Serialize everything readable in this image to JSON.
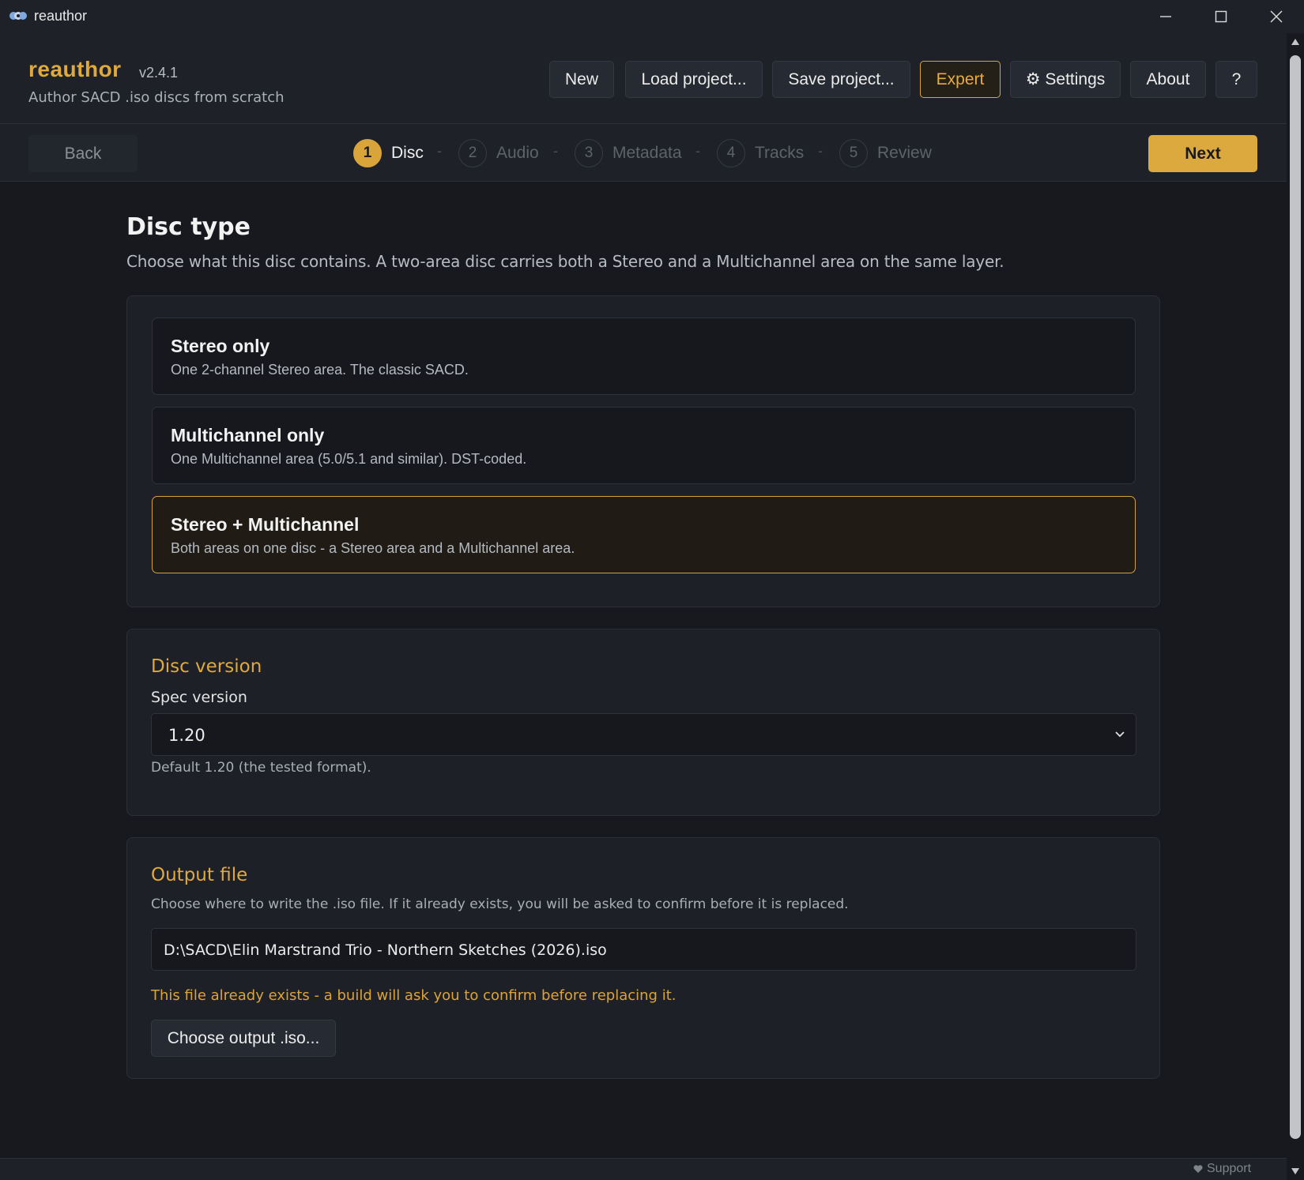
{
  "window": {
    "title": "reauthor"
  },
  "header": {
    "brand": "reauthor",
    "version": "v2.4.1",
    "subtitle": "Author SACD .iso discs from scratch",
    "buttons": {
      "new": "New",
      "load": "Load project...",
      "save": "Save project...",
      "expert": "Expert",
      "settings": "⚙ Settings",
      "about": "About",
      "help": "?"
    }
  },
  "stepper": {
    "back": "Back",
    "next": "Next",
    "separator": "-",
    "steps": [
      {
        "num": "1",
        "label": "Disc",
        "active": true
      },
      {
        "num": "2",
        "label": "Audio",
        "active": false
      },
      {
        "num": "3",
        "label": "Metadata",
        "active": false
      },
      {
        "num": "4",
        "label": "Tracks",
        "active": false
      },
      {
        "num": "5",
        "label": "Review",
        "active": false
      }
    ]
  },
  "disc_type": {
    "title": "Disc type",
    "description": "Choose what this disc contains. A two-area disc carries both a Stereo and a Multichannel area on the same layer.",
    "options": [
      {
        "title": "Stereo only",
        "desc": "One 2-channel Stereo area. The classic SACD.",
        "selected": false
      },
      {
        "title": "Multichannel only",
        "desc": "One Multichannel area (5.0/5.1 and similar). DST-coded.",
        "selected": false
      },
      {
        "title": "Stereo + Multichannel",
        "desc": "Both areas on one disc - a Stereo area and a Multichannel area.",
        "selected": true
      }
    ]
  },
  "disc_version": {
    "title": "Disc version",
    "label": "Spec version",
    "value": "1.20",
    "hint": "Default 1.20 (the tested format)."
  },
  "output_file": {
    "title": "Output file",
    "description": "Choose where to write the .iso file. If it already exists, you will be asked to confirm before it is replaced.",
    "path": "D:\\SACD\\Elin Marstrand Trio - Northern Sketches (2026).iso",
    "warning": "This file already exists - a build will ask you to confirm before replacing it.",
    "choose_button": "Choose output .iso..."
  },
  "footer": {
    "support": "Support"
  },
  "colors": {
    "accent": "#dba93e",
    "background": "#17191e",
    "panel": "#1d2027"
  },
  "icons": [
    "app-icon",
    "minimize-icon",
    "maximize-icon",
    "close-icon",
    "chevron-down-icon",
    "heart-icon"
  ]
}
